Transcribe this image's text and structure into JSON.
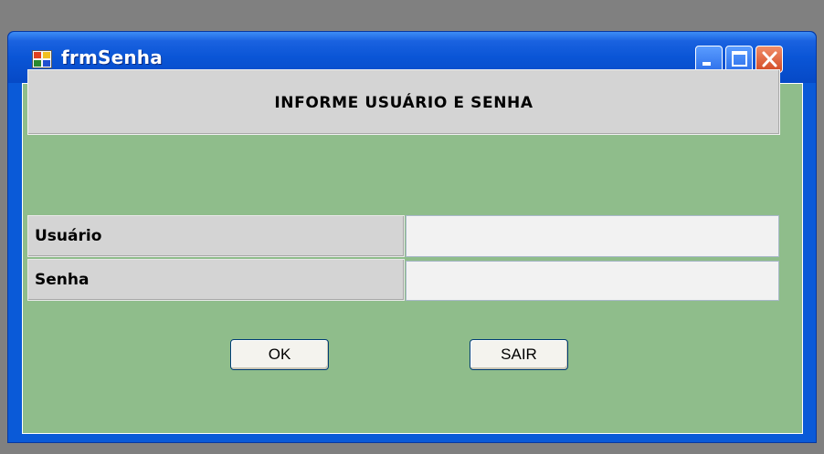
{
  "window": {
    "title": "frmSenha",
    "icon": "form-app-icon",
    "controls": [
      "minimize-icon",
      "maximize-icon",
      "close-icon"
    ]
  },
  "form": {
    "heading": "INFORME USUÁRIO E SENHA",
    "fields": [
      {
        "label": "Usuário",
        "value": ""
      },
      {
        "label": "Senha",
        "value": ""
      }
    ],
    "buttons": {
      "ok": "OK",
      "exit": "SAIR"
    }
  },
  "colors": {
    "titlebar": "#0a55d6",
    "client_background": "#8fbd8b",
    "panel": "#d4d4d4",
    "close_button": "#d24a24"
  }
}
